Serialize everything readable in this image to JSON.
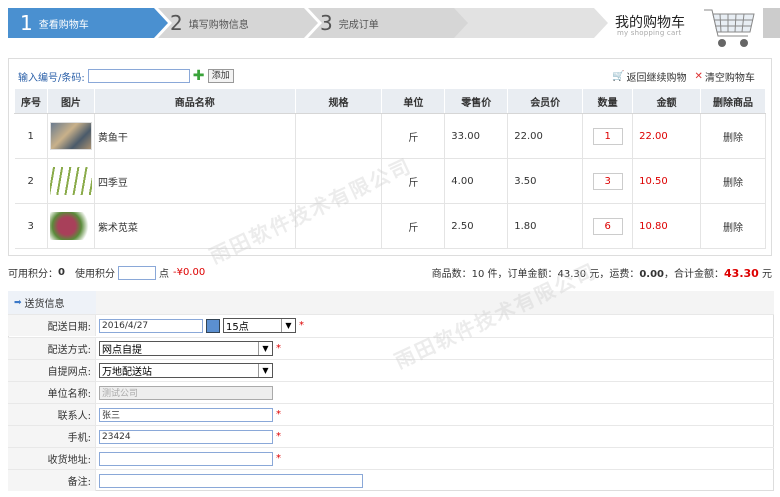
{
  "steps": [
    {
      "num": "1",
      "label": "查看购物车"
    },
    {
      "num": "2",
      "label": "填写购物信息"
    },
    {
      "num": "3",
      "label": "完成订单"
    }
  ],
  "header": {
    "title": "我的购物车",
    "subtitle": "my shopping cart"
  },
  "toolbar": {
    "code_label": "输入编号/条码:",
    "code_value": "",
    "add_label": "添加",
    "continue_label": "返回继续购物",
    "clear_label": "清空购物车"
  },
  "table": {
    "headers": [
      "序号",
      "图片",
      "商品名称",
      "规格",
      "单位",
      "零售价",
      "会员价",
      "数量",
      "金额",
      "删除商品"
    ],
    "rows": [
      {
        "idx": "1",
        "name": "黄鱼干",
        "spec": "",
        "unit": "斤",
        "retail": "33.00",
        "member": "22.00",
        "qty": "1",
        "amount": "22.00",
        "del": "删除"
      },
      {
        "idx": "2",
        "name": "四季豆",
        "spec": "",
        "unit": "斤",
        "retail": "4.00",
        "member": "3.50",
        "qty": "3",
        "amount": "10.50",
        "del": "删除"
      },
      {
        "idx": "3",
        "name": "紫术苋菜",
        "spec": "",
        "unit": "斤",
        "retail": "2.50",
        "member": "1.80",
        "qty": "6",
        "amount": "10.80",
        "del": "删除"
      }
    ]
  },
  "points": {
    "avail_label": "可用积分：",
    "avail_value": "0",
    "use_label": "使用积分",
    "unit": "点",
    "discount": "-¥0.00"
  },
  "summary": {
    "count_label": "商品数：",
    "count": "10",
    "count_unit": "件，订单金额：",
    "order_amount": "43.30",
    "yuan1": "元，运费：",
    "freight": "0.00",
    "total_label": "，合计金额：",
    "total": "43.30",
    "yuan2": "元"
  },
  "form": {
    "section_title": "送货信息",
    "date_label": "配送日期:",
    "date_value": "2016/4/27",
    "hour_value": "15点",
    "method_label": "配送方式:",
    "method_value": "网点自提",
    "pickup_label": "自提网点:",
    "pickup_value": "万地配送站",
    "company_label": "单位名称:",
    "company_value": "测试公司",
    "contact_label": "联系人:",
    "contact_value": "张三",
    "phone_label": "手机:",
    "phone_value": "23424",
    "address_label": "收货地址:",
    "address_value": "",
    "note_label": "备注:",
    "note_value": "",
    "required_mark": "*"
  },
  "watermark": "雨田软件技术有限公司"
}
